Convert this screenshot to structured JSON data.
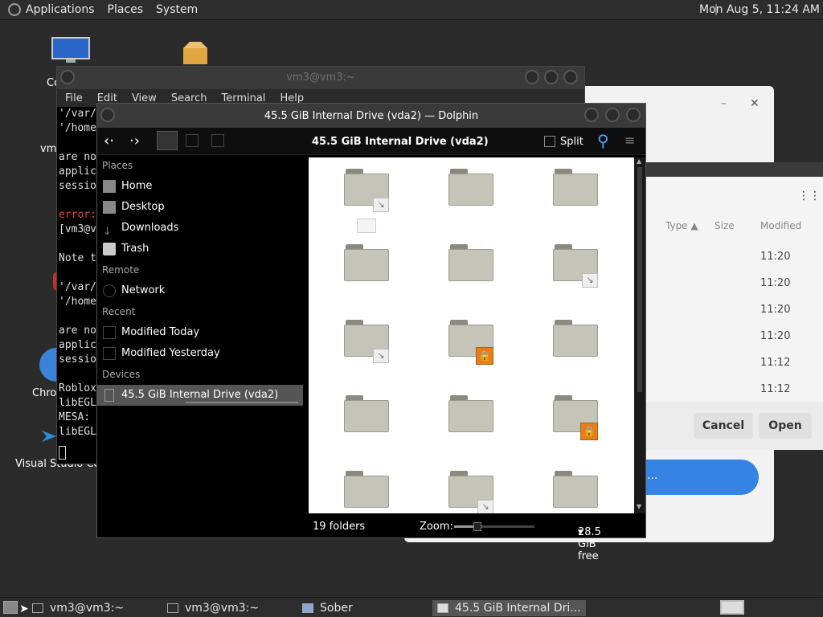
{
  "topbar": {
    "menus": [
      "Applications",
      "Places",
      "System"
    ],
    "clock": "Mon Aug  5, 11:24 AM"
  },
  "desktop": {
    "labels": {
      "computer": "Co",
      "vm": "vm",
      "chrome": "Chro",
      "vscode": "Visual Studio Cod"
    }
  },
  "terminal": {
    "title": "vm3@vm3:~",
    "menu": [
      "File",
      "Edit",
      "View",
      "Search",
      "Terminal",
      "Help"
    ],
    "lines": [
      {
        "text": "'/var/",
        "color": "#e0e0e0"
      },
      {
        "text": "'/home",
        "color": "#e0e0e0"
      },
      {
        "text": "",
        "color": "#e0e0e0"
      },
      {
        "text": "are no",
        "color": "#e0e0e0"
      },
      {
        "text": "applic",
        "color": "#e0e0e0"
      },
      {
        "text": "sessio",
        "color": "#e0e0e0"
      },
      {
        "text": "",
        "color": "#e0e0e0"
      },
      {
        "text": "error:",
        "color": "#e0413a"
      },
      {
        "text": "[vm3@v",
        "color": "#e0e0e0"
      },
      {
        "text": "",
        "color": "#e0e0e0"
      },
      {
        "text": "Note t",
        "color": "#e0e0e0"
      },
      {
        "text": "",
        "color": "#e0e0e0"
      },
      {
        "text": "'/var/",
        "color": "#e0e0e0"
      },
      {
        "text": "'/home",
        "color": "#e0e0e0"
      },
      {
        "text": "",
        "color": "#e0e0e0"
      },
      {
        "text": "are no",
        "color": "#e0e0e0"
      },
      {
        "text": "applic",
        "color": "#e0e0e0"
      },
      {
        "text": "sessio",
        "color": "#e0e0e0"
      },
      {
        "text": "",
        "color": "#e0e0e0"
      },
      {
        "text": "Roblox",
        "color": "#e0e0e0"
      },
      {
        "text": "libEGL",
        "color": "#e0e0e0"
      },
      {
        "text": "MESA:",
        "color": "#e0e0e0"
      },
      {
        "text": "libEGL",
        "color": "#e0e0e0"
      }
    ]
  },
  "chooser": {
    "columns": {
      "type": "Type",
      "size": "Size",
      "modified": "Modified"
    },
    "times": [
      "11:20",
      "11:20",
      "11:20",
      "11:20",
      "11:12",
      "11:12"
    ],
    "cancel": "Cancel",
    "open": "Open",
    "blue_button": "..."
  },
  "dolphin": {
    "title": "45.5 GiB Internal Drive (vda2) — Dolphin",
    "location": "45.5 GiB Internal Drive (vda2)",
    "split_label": "Split",
    "sidebar": {
      "places_heading": "Places",
      "places": [
        {
          "label": "Home",
          "icon": "home-icon"
        },
        {
          "label": "Desktop",
          "icon": "desktop-icon"
        },
        {
          "label": "Downloads",
          "icon": "downloads-icon"
        },
        {
          "label": "Trash",
          "icon": "trash-icon"
        }
      ],
      "remote_heading": "Remote",
      "remote": [
        {
          "label": "Network",
          "icon": "network-icon"
        }
      ],
      "recent_heading": "Recent",
      "recent": [
        {
          "label": "Modified Today",
          "icon": "calendar-icon"
        },
        {
          "label": "Modified Yesterday",
          "icon": "calendar-icon"
        }
      ],
      "devices_heading": "Devices",
      "devices": [
        {
          "label": "45.5 GiB Internal Drive (vda2)",
          "icon": "drive-icon"
        }
      ]
    },
    "status": {
      "count": "19 folders",
      "zoom_label": "Zoom:",
      "free": "28.5 GiB free"
    }
  },
  "taskbar": {
    "tasks": [
      "vm3@vm3:~",
      "vm3@vm3:~",
      "Sober",
      "45.5 GiB Internal Dri..."
    ]
  }
}
